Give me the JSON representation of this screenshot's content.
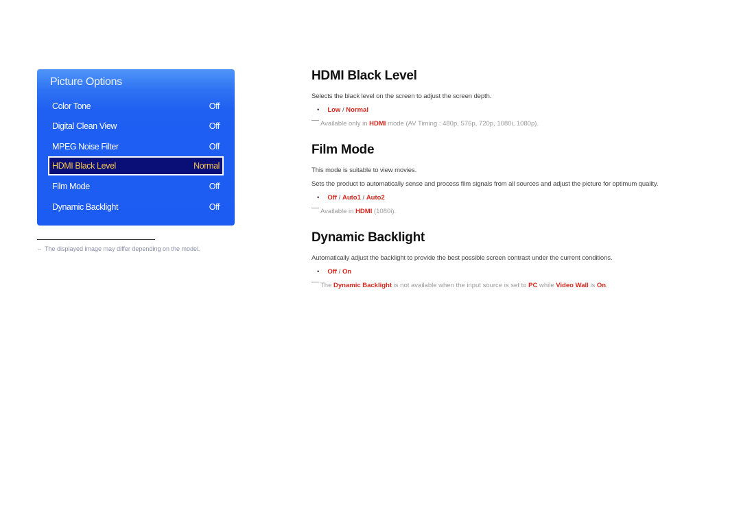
{
  "panel": {
    "title": "Picture Options",
    "items": [
      {
        "label": "Color Tone",
        "value": "Off"
      },
      {
        "label": "Digital Clean View",
        "value": "Off"
      },
      {
        "label": "MPEG Noise Filter",
        "value": "Off"
      },
      {
        "label": "HDMI Black Level",
        "value": "Normal"
      },
      {
        "label": "Film Mode",
        "value": "Off"
      },
      {
        "label": "Dynamic Backlight",
        "value": "Off"
      }
    ],
    "selected_index": 3
  },
  "footnote": "The displayed image may differ depending on the model.",
  "sections": {
    "hdmi": {
      "title": "HDMI Black Level",
      "desc": "Selects the black level on the screen to adjust the screen depth.",
      "options": [
        "Low",
        "Normal"
      ],
      "note_pre": "Available only in ",
      "note_hl": "HDMI",
      "note_post": " mode (AV Timing : 480p, 576p, 720p, 1080i, 1080p)."
    },
    "film": {
      "title": "Film Mode",
      "desc1": "This mode is suitable to view movies.",
      "desc2": "Sets the product to automatically sense and process film signals from all sources and adjust the picture for optimum quality.",
      "options": [
        "Off",
        "Auto1",
        "Auto2"
      ],
      "note_pre": "Available in ",
      "note_hl": "HDMI",
      "note_post": " (1080i)."
    },
    "backlight": {
      "title": "Dynamic Backlight",
      "desc": "Automatically adjust the backlight to provide the best possible screen contrast under the current conditions.",
      "options": [
        "Off",
        "On"
      ],
      "note": {
        "t1": "The ",
        "h1": "Dynamic Backlight",
        "t2": " is not available when the input source is set to ",
        "h2": "PC",
        "t3": " while ",
        "h3": "Video Wall",
        "t4": " is ",
        "h4": "On",
        "t5": "."
      }
    }
  },
  "separator": " / ",
  "colors": {
    "accent_red": "#d9261c",
    "panel_blue": "#1d5cf2",
    "selected_bg": "#0a0f78",
    "selected_text": "#f6c44a"
  }
}
